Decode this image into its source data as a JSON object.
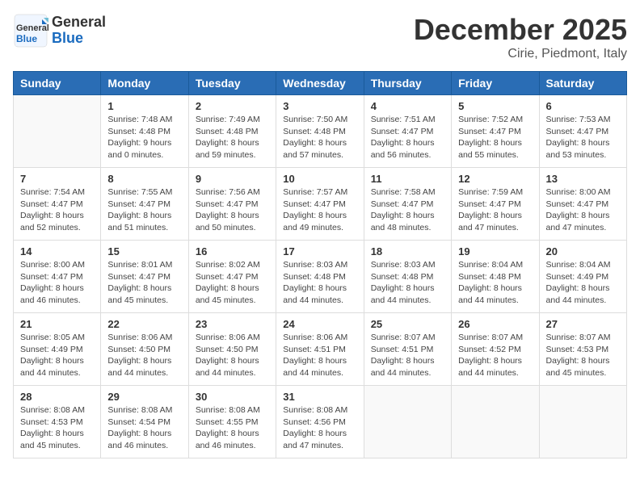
{
  "header": {
    "logo_line1": "General",
    "logo_line2": "Blue",
    "month_title": "December 2025",
    "location": "Cirie, Piedmont, Italy"
  },
  "days_of_week": [
    "Sunday",
    "Monday",
    "Tuesday",
    "Wednesday",
    "Thursday",
    "Friday",
    "Saturday"
  ],
  "weeks": [
    [
      {
        "day": "",
        "info": ""
      },
      {
        "day": "1",
        "info": "Sunrise: 7:48 AM\nSunset: 4:48 PM\nDaylight: 9 hours\nand 0 minutes."
      },
      {
        "day": "2",
        "info": "Sunrise: 7:49 AM\nSunset: 4:48 PM\nDaylight: 8 hours\nand 59 minutes."
      },
      {
        "day": "3",
        "info": "Sunrise: 7:50 AM\nSunset: 4:48 PM\nDaylight: 8 hours\nand 57 minutes."
      },
      {
        "day": "4",
        "info": "Sunrise: 7:51 AM\nSunset: 4:47 PM\nDaylight: 8 hours\nand 56 minutes."
      },
      {
        "day": "5",
        "info": "Sunrise: 7:52 AM\nSunset: 4:47 PM\nDaylight: 8 hours\nand 55 minutes."
      },
      {
        "day": "6",
        "info": "Sunrise: 7:53 AM\nSunset: 4:47 PM\nDaylight: 8 hours\nand 53 minutes."
      }
    ],
    [
      {
        "day": "7",
        "info": "Sunrise: 7:54 AM\nSunset: 4:47 PM\nDaylight: 8 hours\nand 52 minutes."
      },
      {
        "day": "8",
        "info": "Sunrise: 7:55 AM\nSunset: 4:47 PM\nDaylight: 8 hours\nand 51 minutes."
      },
      {
        "day": "9",
        "info": "Sunrise: 7:56 AM\nSunset: 4:47 PM\nDaylight: 8 hours\nand 50 minutes."
      },
      {
        "day": "10",
        "info": "Sunrise: 7:57 AM\nSunset: 4:47 PM\nDaylight: 8 hours\nand 49 minutes."
      },
      {
        "day": "11",
        "info": "Sunrise: 7:58 AM\nSunset: 4:47 PM\nDaylight: 8 hours\nand 48 minutes."
      },
      {
        "day": "12",
        "info": "Sunrise: 7:59 AM\nSunset: 4:47 PM\nDaylight: 8 hours\nand 47 minutes."
      },
      {
        "day": "13",
        "info": "Sunrise: 8:00 AM\nSunset: 4:47 PM\nDaylight: 8 hours\nand 47 minutes."
      }
    ],
    [
      {
        "day": "14",
        "info": "Sunrise: 8:00 AM\nSunset: 4:47 PM\nDaylight: 8 hours\nand 46 minutes."
      },
      {
        "day": "15",
        "info": "Sunrise: 8:01 AM\nSunset: 4:47 PM\nDaylight: 8 hours\nand 45 minutes."
      },
      {
        "day": "16",
        "info": "Sunrise: 8:02 AM\nSunset: 4:47 PM\nDaylight: 8 hours\nand 45 minutes."
      },
      {
        "day": "17",
        "info": "Sunrise: 8:03 AM\nSunset: 4:48 PM\nDaylight: 8 hours\nand 44 minutes."
      },
      {
        "day": "18",
        "info": "Sunrise: 8:03 AM\nSunset: 4:48 PM\nDaylight: 8 hours\nand 44 minutes."
      },
      {
        "day": "19",
        "info": "Sunrise: 8:04 AM\nSunset: 4:48 PM\nDaylight: 8 hours\nand 44 minutes."
      },
      {
        "day": "20",
        "info": "Sunrise: 8:04 AM\nSunset: 4:49 PM\nDaylight: 8 hours\nand 44 minutes."
      }
    ],
    [
      {
        "day": "21",
        "info": "Sunrise: 8:05 AM\nSunset: 4:49 PM\nDaylight: 8 hours\nand 44 minutes."
      },
      {
        "day": "22",
        "info": "Sunrise: 8:06 AM\nSunset: 4:50 PM\nDaylight: 8 hours\nand 44 minutes."
      },
      {
        "day": "23",
        "info": "Sunrise: 8:06 AM\nSunset: 4:50 PM\nDaylight: 8 hours\nand 44 minutes."
      },
      {
        "day": "24",
        "info": "Sunrise: 8:06 AM\nSunset: 4:51 PM\nDaylight: 8 hours\nand 44 minutes."
      },
      {
        "day": "25",
        "info": "Sunrise: 8:07 AM\nSunset: 4:51 PM\nDaylight: 8 hours\nand 44 minutes."
      },
      {
        "day": "26",
        "info": "Sunrise: 8:07 AM\nSunset: 4:52 PM\nDaylight: 8 hours\nand 44 minutes."
      },
      {
        "day": "27",
        "info": "Sunrise: 8:07 AM\nSunset: 4:53 PM\nDaylight: 8 hours\nand 45 minutes."
      }
    ],
    [
      {
        "day": "28",
        "info": "Sunrise: 8:08 AM\nSunset: 4:53 PM\nDaylight: 8 hours\nand 45 minutes."
      },
      {
        "day": "29",
        "info": "Sunrise: 8:08 AM\nSunset: 4:54 PM\nDaylight: 8 hours\nand 46 minutes."
      },
      {
        "day": "30",
        "info": "Sunrise: 8:08 AM\nSunset: 4:55 PM\nDaylight: 8 hours\nand 46 minutes."
      },
      {
        "day": "31",
        "info": "Sunrise: 8:08 AM\nSunset: 4:56 PM\nDaylight: 8 hours\nand 47 minutes."
      },
      {
        "day": "",
        "info": ""
      },
      {
        "day": "",
        "info": ""
      },
      {
        "day": "",
        "info": ""
      }
    ]
  ]
}
